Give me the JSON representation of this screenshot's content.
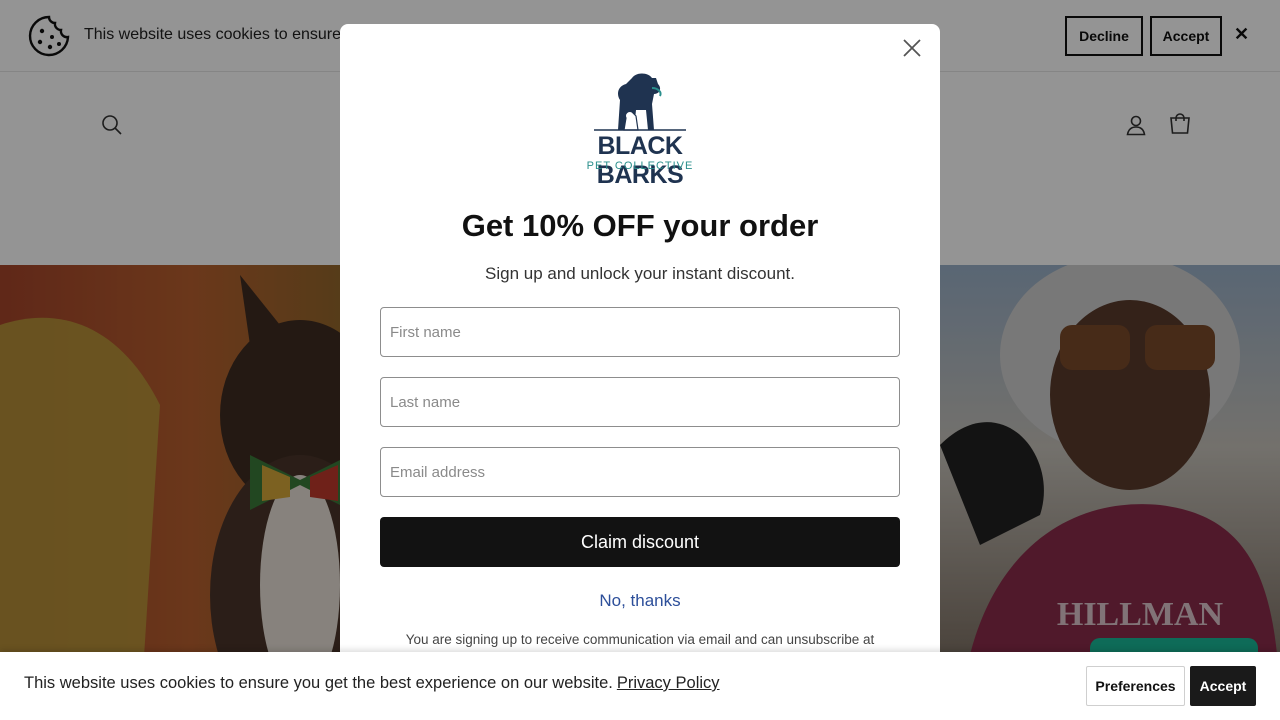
{
  "top_cookie": {
    "message": "This website uses cookies to ensure",
    "decline_label": "Decline",
    "accept_label": "Accept",
    "close_glyph": "✕"
  },
  "header": {
    "icons": [
      "search-icon",
      "account-icon",
      "cart-icon"
    ]
  },
  "modal": {
    "brand_name": "BLACK BARKS",
    "brand_sub": "PET COLLECTIVE",
    "title": "Get 10% OFF your order",
    "subtitle": "Sign up and unlock your instant discount.",
    "first_name_placeholder": "First name",
    "last_name_placeholder": "Last name",
    "email_placeholder": "Email address",
    "claim_label": "Claim discount",
    "no_thanks_label": "No, thanks",
    "disclaimer": "You are signing up to receive communication via email and can unsubscribe at"
  },
  "bottom_cookie": {
    "message": "This website uses cookies to ensure you get the best experience on our website.",
    "privacy_link": "Privacy Policy",
    "preferences_label": "Preferences",
    "accept_label": "Accept"
  },
  "colors": {
    "brand_navy": "#1f3350",
    "brand_teal": "#2a8f8c",
    "button_dark": "#121212",
    "link_blue": "#2d4f9a",
    "chat_green": "#0e6b58"
  }
}
